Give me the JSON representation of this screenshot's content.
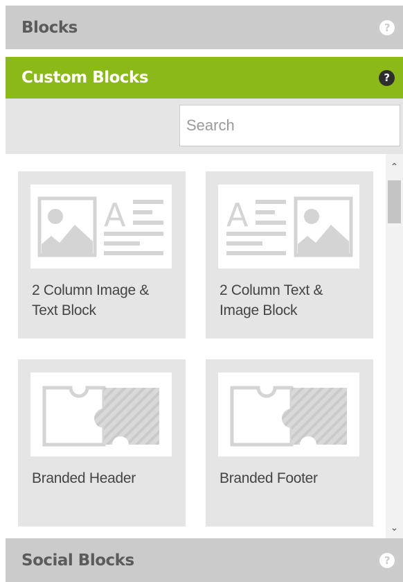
{
  "accordion": {
    "blocks_title": "Blocks",
    "custom_title": "Custom Blocks",
    "social_title": "Social Blocks",
    "help_glyph": "?"
  },
  "search": {
    "placeholder": "Search",
    "value": ""
  },
  "cards": [
    {
      "label": "2 Column Image & Text Block",
      "thumbnail_icon": "image-text-layout-icon"
    },
    {
      "label": "2 Column Text & Image Block",
      "thumbnail_icon": "text-image-layout-icon"
    },
    {
      "label": "Branded Header",
      "thumbnail_icon": "puzzle-piece-icon"
    },
    {
      "label": "Branded Footer",
      "thumbnail_icon": "puzzle-piece-icon"
    }
  ],
  "scrollbar": {
    "up_glyph": "⌃",
    "down_glyph": "⌄"
  },
  "colors": {
    "active_header": "#8bb918",
    "inactive_header": "#cbcbcb",
    "card_bg": "#e5e5e5"
  }
}
